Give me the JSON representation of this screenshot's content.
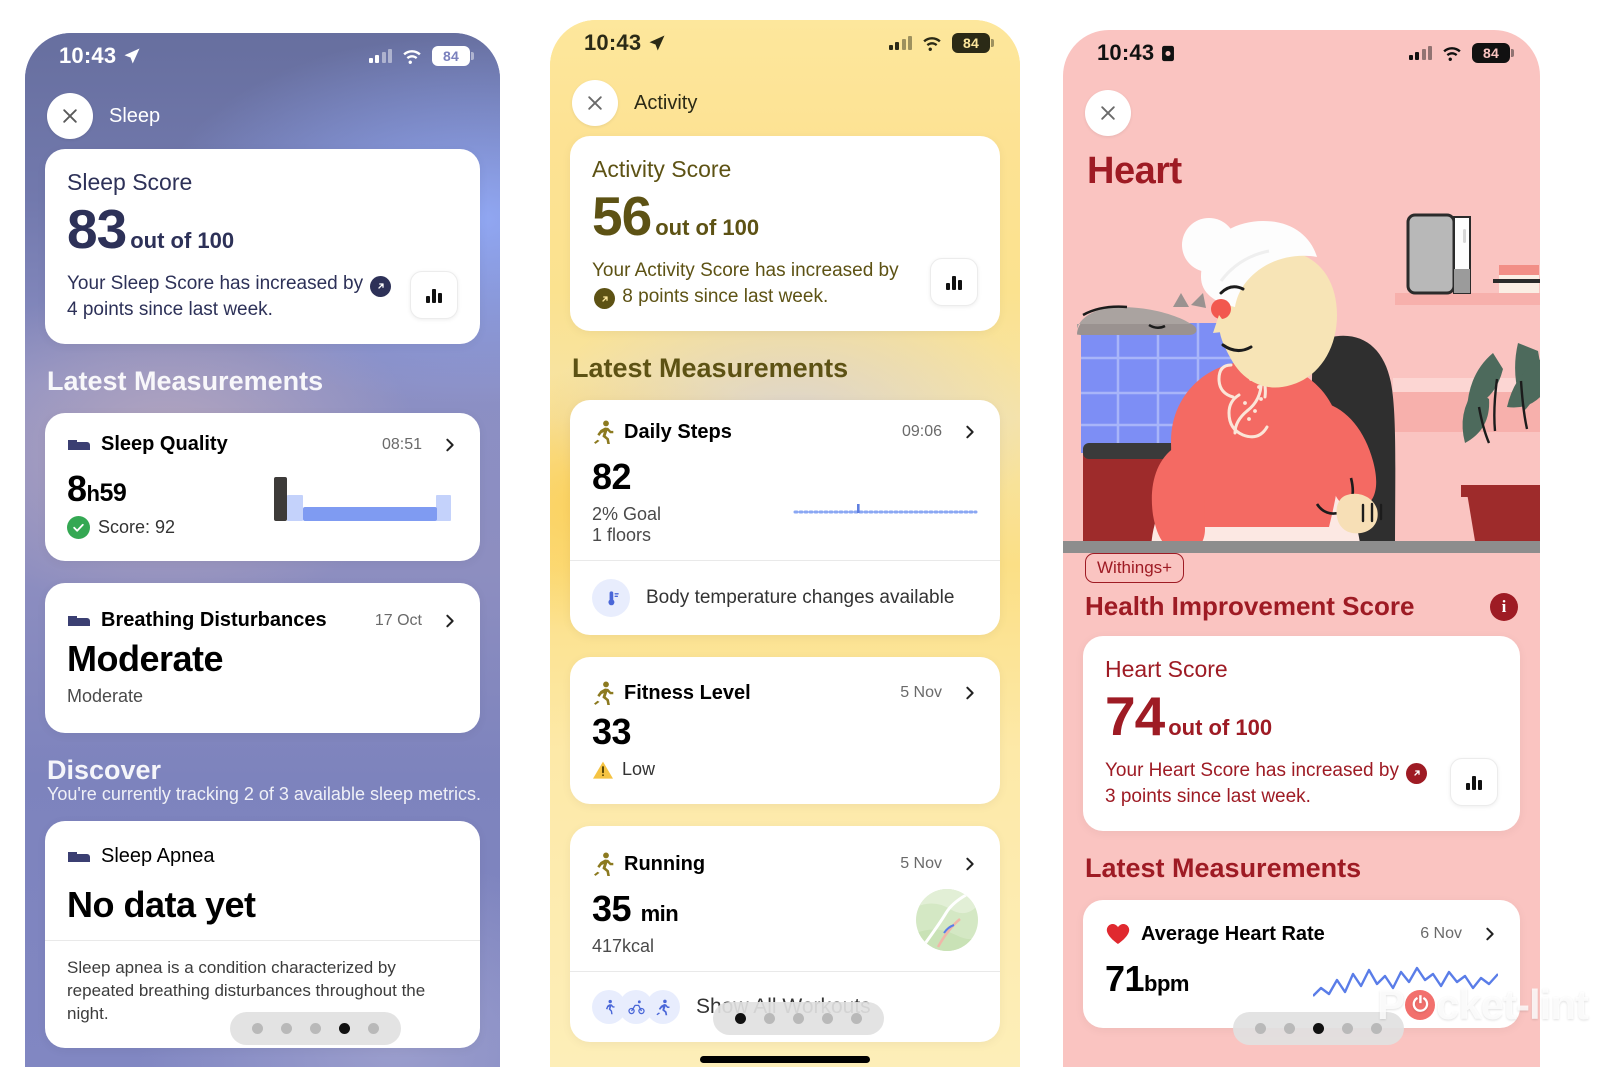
{
  "colors": {
    "sleep_bg": "#7a80bd",
    "sleep_ink": "#2d3158",
    "activity_bg": "#fbe18b",
    "activity_ink": "#5d5214",
    "heart_bg": "#fac4c1",
    "heart_ink": "#9e1b24",
    "accent_blue": "#6f8ef5",
    "accent_green": "#34a853",
    "accent_red": "#e63b41"
  },
  "status_bar": {
    "time": "10:43",
    "battery": "84",
    "location_icon": "location-arrow-icon",
    "recording_icon": "screen-record-icon",
    "signal_icon": "cellular-signal-icon",
    "wifi_icon": "wifi-icon"
  },
  "panels": [
    {
      "id": "sleep",
      "nav_title": "Sleep",
      "close_icon": "close-icon",
      "score_card": {
        "label": "Sleep Score",
        "value": "83",
        "out_of": "out of 100",
        "text_before": "Your Sleep Score has increased by",
        "trend_icon": "trend-up-arrow-icon",
        "delta": "4",
        "text_after": "points since last week.",
        "chart_button_icon": "bar-chart-icon"
      },
      "section_title": "Latest Measurements",
      "measurements": [
        {
          "icon": "bed-icon",
          "name": "Sleep Quality",
          "date": "08:51",
          "value_main": "8",
          "value_unit": "h",
          "value_rest": "59",
          "sub_icon": "check-circle-icon",
          "sub": "Score: 92",
          "chevron_icon": "chevron-right-icon",
          "chart_icon": "sleep-bed-bar-icon"
        },
        {
          "icon": "bed-icon",
          "name": "Breathing Disturbances",
          "date": "17 Oct",
          "value_main": "Moderate",
          "sub": "Moderate",
          "chevron_icon": "chevron-right-icon"
        }
      ],
      "discover": {
        "title": "Discover",
        "subtitle": "You're currently tracking 2 of 3 available sleep metrics.",
        "card": {
          "icon": "bed-icon",
          "name": "Sleep Apnea",
          "value": "No data yet",
          "description": "Sleep apnea is a condition characterized by repeated breathing disturbances throughout the night."
        }
      },
      "dots": {
        "count": 5,
        "active": 3
      }
    },
    {
      "id": "activity",
      "nav_title": "Activity",
      "close_icon": "close-icon",
      "score_card": {
        "label": "Activity Score",
        "value": "56",
        "out_of": "out of 100",
        "text_before": "Your Activity Score has increased by",
        "trend_icon": "trend-up-arrow-icon",
        "delta": "",
        "text_after": "8 points since last week.",
        "chart_button_icon": "bar-chart-icon"
      },
      "section_title": "Latest Measurements",
      "measurements": [
        {
          "icon": "running-icon",
          "name": "Daily Steps",
          "date": "09:06",
          "value_main": "82",
          "sub_line_1": "2% Goal",
          "sub_line_2": "1 floors",
          "chevron_icon": "chevron-right-icon",
          "chart_icon": "dotted-line-chart-icon",
          "footer_icon": "thermometer-icon",
          "footer_label": "Body temperature changes available"
        },
        {
          "icon": "running-icon",
          "name": "Fitness Level",
          "date": "5 Nov",
          "value_main": "33",
          "sub_icon": "warning-triangle-icon",
          "sub": "Low",
          "chevron_icon": "chevron-right-icon"
        },
        {
          "icon": "running-icon",
          "name": "Running",
          "date": "5 Nov",
          "value_main": "35",
          "value_unit": "min",
          "sub": "417kcal",
          "chevron_icon": "chevron-right-icon",
          "thumbnail": "route-map-thumbnail",
          "footer_icons": [
            "walk-icon",
            "cycle-icon",
            "run-icon"
          ],
          "footer_label": "Show All Workouts"
        }
      ],
      "dots": {
        "count": 5,
        "active": 0
      }
    },
    {
      "id": "heart",
      "close_icon": "close-icon",
      "hero_title": "Heart",
      "illustration": "elderly-woman-armchair-illustration",
      "pill": "Withings+",
      "his_title": "Health Improvement Score",
      "info_icon": "info-icon",
      "score_card": {
        "label": "Heart Score",
        "value": "74",
        "out_of": "out of 100",
        "text_before": "Your Heart Score has increased by",
        "trend_icon": "trend-up-arrow-icon",
        "delta": "3",
        "text_after": "points since last week.",
        "chart_button_icon": "bar-chart-icon"
      },
      "section_title": "Latest Measurements",
      "measurements": [
        {
          "icon": "heart-icon",
          "name": "Average Heart Rate",
          "date": "6 Nov",
          "value_main": "71",
          "value_unit": "bpm",
          "chevron_icon": "chevron-right-icon",
          "chart_icon": "heart-rate-line-chart-icon"
        }
      ],
      "dots": {
        "count": 5,
        "active": 2
      }
    }
  ],
  "watermark": {
    "text_a": "P",
    "text_b": "cket-lint",
    "icon": "power-logo-icon"
  }
}
